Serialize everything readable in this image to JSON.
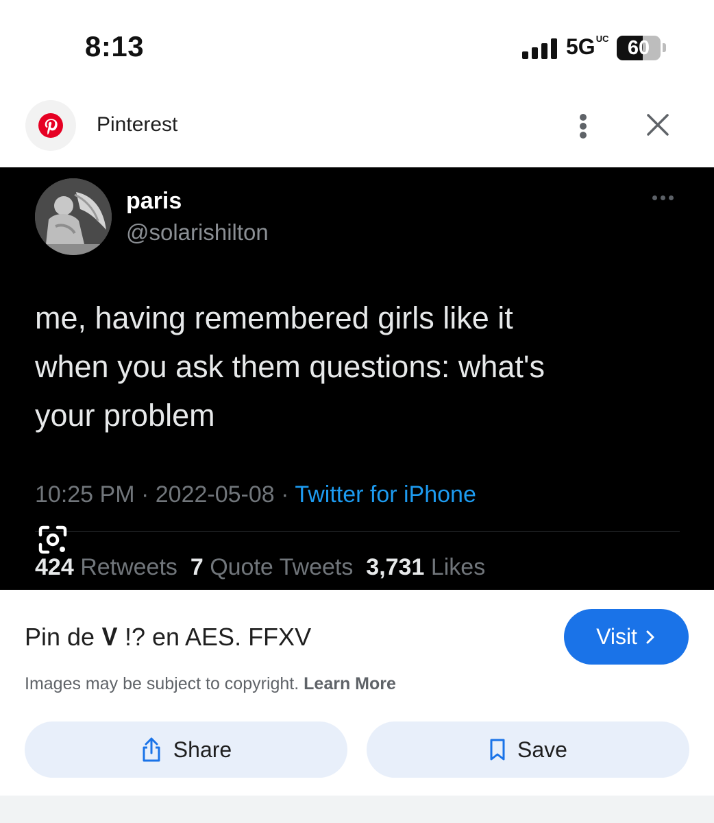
{
  "status_bar": {
    "time": "8:13",
    "network": "5G",
    "network_badge": "UC",
    "battery_level": "60",
    "battery_fraction": 0.6
  },
  "source": {
    "name": "Pinterest",
    "logo_icon": "pinterest-logo-icon",
    "brand_color": "#e60023"
  },
  "tweet": {
    "display_name": "paris",
    "handle": "@solarishilton",
    "text": "me, having remembered girls like it\nwhen you ask them questions: what's\nyour problem",
    "time": "10:25 PM",
    "date": "2022-05-08",
    "separator": "·",
    "source_app": "Twitter for iPhone",
    "stats": {
      "retweets_count": "424",
      "retweets_label": "Retweets",
      "quotes_count": "7",
      "quotes_label": "Quote Tweets",
      "likes_count": "3,731",
      "likes_label": "Likes"
    }
  },
  "pin": {
    "title": "Pin de 𝐕 !? en AES. FFXV",
    "visit_label": "Visit",
    "copyright_text": "Images may be subject to copyright.",
    "learn_more_label": "Learn More"
  },
  "actions": {
    "share_label": "Share",
    "save_label": "Save"
  },
  "colors": {
    "accent": "#1a73e8",
    "action_bg": "#e8effa",
    "tweet_bg": "#000000",
    "tweet_link": "#1d9bf0"
  }
}
